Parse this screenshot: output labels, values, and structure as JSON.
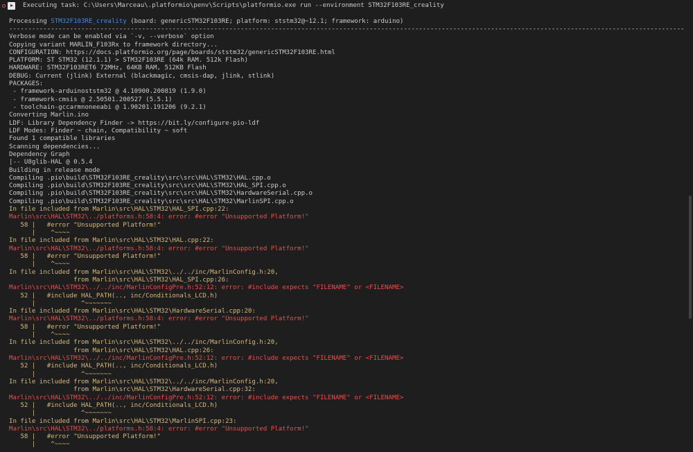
{
  "task": {
    "title": "Executing task: C:\\Users\\Marceau\\.platformio\\penv\\Scripts\\platformio.exe run --environment STM32F103RE_creality"
  },
  "colors": {
    "background": "#1e1e1e",
    "text": "#cccccc",
    "environment": "#3b8eea",
    "warning": "#d7ba7d",
    "error": "#f14c4c"
  },
  "icons": [
    "radio-icon",
    "play-icon"
  ],
  "lines": [
    {
      "parts": [
        {
          "t": "Processing ",
          "c": "def"
        },
        {
          "t": "STM32F103RE_creality",
          "c": "env"
        },
        {
          "t": " (board: genericSTM32F103RE; platform: ststm32@~12.1; framework: arduino)",
          "c": "def"
        }
      ]
    },
    {
      "parts": [
        {
          "t": "----------------------------------------------------------------------------------------------------------------------------------------------------------------------------------------------------",
          "c": "def"
        }
      ]
    },
    {
      "parts": [
        {
          "t": "Verbose mode can be enabled via `-v, --verbose` option",
          "c": "def"
        }
      ]
    },
    {
      "parts": [
        {
          "t": "Copying variant MARLIN_F103Rx to framework directory...",
          "c": "def"
        }
      ]
    },
    {
      "parts": [
        {
          "t": "CONFIGURATION: https://docs.platformio.org/page/boards/ststm32/genericSTM32F103RE.html",
          "c": "def"
        }
      ]
    },
    {
      "parts": [
        {
          "t": "PLATFORM: ST STM32 (12.1.1) > STM32F103RE (64k RAM. 512k Flash)",
          "c": "def"
        }
      ]
    },
    {
      "parts": [
        {
          "t": "HARDWARE: STM32F103RET6 72MHz, 64KB RAM, 512KB Flash",
          "c": "def"
        }
      ]
    },
    {
      "parts": [
        {
          "t": "DEBUG: Current (jlink) External (blackmagic, cmsis-dap, jlink, stlink)",
          "c": "def"
        }
      ]
    },
    {
      "parts": [
        {
          "t": "PACKAGES:",
          "c": "def"
        }
      ]
    },
    {
      "parts": [
        {
          "t": " - framework-arduinoststm32 @ 4.10900.200819 (1.9.0)",
          "c": "def"
        }
      ]
    },
    {
      "parts": [
        {
          "t": " - framework-cmsis @ 2.50501.200527 (5.5.1)",
          "c": "def"
        }
      ]
    },
    {
      "parts": [
        {
          "t": " - toolchain-gccarmnoneeabi @ 1.90201.191206 (9.2.1)",
          "c": "def"
        }
      ]
    },
    {
      "parts": [
        {
          "t": "Converting Marlin.ino",
          "c": "def"
        }
      ]
    },
    {
      "parts": [
        {
          "t": "LDF: Library Dependency Finder -> https://bit.ly/configure-pio-ldf",
          "c": "def"
        }
      ]
    },
    {
      "parts": [
        {
          "t": "LDF Modes: Finder ~ chain, Compatibility ~ soft",
          "c": "def"
        }
      ]
    },
    {
      "parts": [
        {
          "t": "Found 1 compatible libraries",
          "c": "def"
        }
      ]
    },
    {
      "parts": [
        {
          "t": "Scanning dependencies...",
          "c": "def"
        }
      ]
    },
    {
      "parts": [
        {
          "t": "Dependency Graph",
          "c": "def"
        }
      ]
    },
    {
      "parts": [
        {
          "t": "|-- U8glib-HAL @ 0.5.4",
          "c": "def"
        }
      ]
    },
    {
      "parts": [
        {
          "t": "Building in release mode",
          "c": "def"
        }
      ]
    },
    {
      "parts": [
        {
          "t": "Compiling .pio\\build\\STM32F103RE_creality\\src\\src\\HAL\\STM32\\HAL.cpp.o",
          "c": "def"
        }
      ]
    },
    {
      "parts": [
        {
          "t": "Compiling .pio\\build\\STM32F103RE_creality\\src\\src\\HAL\\STM32\\HAL_SPI.cpp.o",
          "c": "def"
        }
      ]
    },
    {
      "parts": [
        {
          "t": "Compiling .pio\\build\\STM32F103RE_creality\\src\\src\\HAL\\STM32\\HardwareSerial.cpp.o",
          "c": "def"
        }
      ]
    },
    {
      "parts": [
        {
          "t": "Compiling .pio\\build\\STM32F103RE_creality\\src\\src\\HAL\\STM32\\MarlinSPI.cpp.o",
          "c": "def"
        }
      ]
    },
    {
      "parts": [
        {
          "t": "In file included from Marlin\\src\\HAL\\STM32\\HAL_SPI.cpp:22:",
          "c": "warn"
        }
      ]
    },
    {
      "parts": [
        {
          "t": "Marlin\\src\\HAL\\STM32\\../platforms.h:58:4: error: #error \"Unsupported Platform!\"",
          "c": "err"
        }
      ]
    },
    {
      "parts": [
        {
          "t": "   58 |   #error \"Unsupported Platform!\"",
          "c": "warn"
        }
      ]
    },
    {
      "parts": [
        {
          "t": "      |    ^~~~~",
          "c": "warn"
        }
      ]
    },
    {
      "parts": [
        {
          "t": "In file included from Marlin\\src\\HAL\\STM32\\HAL.cpp:22:",
          "c": "warn"
        }
      ]
    },
    {
      "parts": [
        {
          "t": "Marlin\\src\\HAL\\STM32\\../platforms.h:58:4: error: #error \"Unsupported Platform!\"",
          "c": "err"
        }
      ]
    },
    {
      "parts": [
        {
          "t": "   58 |   #error \"Unsupported Platform!\"",
          "c": "warn"
        }
      ]
    },
    {
      "parts": [
        {
          "t": "      |    ^~~~~",
          "c": "warn"
        }
      ]
    },
    {
      "parts": [
        {
          "t": "In file included from Marlin\\src\\HAL\\STM32\\../../inc/MarlinConfig.h:20,",
          "c": "warn"
        }
      ]
    },
    {
      "parts": [
        {
          "t": "                 from Marlin\\src\\HAL\\STM32\\HAL_SPI.cpp:26:",
          "c": "warn"
        }
      ]
    },
    {
      "parts": [
        {
          "t": "Marlin\\src\\HAL\\STM32\\../../inc/MarlinConfigPre.h:52:12: error: #include expects \"FILENAME\" or <FILENAME>",
          "c": "err"
        }
      ]
    },
    {
      "parts": [
        {
          "t": "   52 |   #include HAL_PATH(.., inc/Conditionals_LCD.h)",
          "c": "warn"
        }
      ]
    },
    {
      "parts": [
        {
          "t": "      |            ^~~~~~~~",
          "c": "warn"
        }
      ]
    },
    {
      "parts": [
        {
          "t": "In file included from Marlin\\src\\HAL\\STM32\\HardwareSerial.cpp:20:",
          "c": "warn"
        }
      ]
    },
    {
      "parts": [
        {
          "t": "Marlin\\src\\HAL\\STM32\\../platforms.h:58:4: error: #error \"Unsupported Platform!\"",
          "c": "err"
        }
      ]
    },
    {
      "parts": [
        {
          "t": "   58 |   #error \"Unsupported Platform!\"",
          "c": "warn"
        }
      ]
    },
    {
      "parts": [
        {
          "t": "      |    ^~~~~",
          "c": "warn"
        }
      ]
    },
    {
      "parts": [
        {
          "t": "In file included from Marlin\\src\\HAL\\STM32\\../../inc/MarlinConfig.h:20,",
          "c": "warn"
        }
      ]
    },
    {
      "parts": [
        {
          "t": "                 from Marlin\\src\\HAL\\STM32\\HAL.cpp:26:",
          "c": "warn"
        }
      ]
    },
    {
      "parts": [
        {
          "t": "Marlin\\src\\HAL\\STM32\\../../inc/MarlinConfigPre.h:52:12: error: #include expects \"FILENAME\" or <FILENAME>",
          "c": "err"
        }
      ]
    },
    {
      "parts": [
        {
          "t": "   52 |   #include HAL_PATH(.., inc/Conditionals_LCD.h)",
          "c": "warn"
        }
      ]
    },
    {
      "parts": [
        {
          "t": "      |            ^~~~~~~~",
          "c": "warn"
        }
      ]
    },
    {
      "parts": [
        {
          "t": "In file included from Marlin\\src\\HAL\\STM32\\../../inc/MarlinConfig.h:20,",
          "c": "warn"
        }
      ]
    },
    {
      "parts": [
        {
          "t": "                 from Marlin\\src\\HAL\\STM32\\HardwareSerial.cpp:32:",
          "c": "warn"
        }
      ]
    },
    {
      "parts": [
        {
          "t": "Marlin\\src\\HAL\\STM32\\../../inc/MarlinConfigPre.h:52:12: error: #include expects \"FILENAME\" or <FILENAME>",
          "c": "err"
        }
      ]
    },
    {
      "parts": [
        {
          "t": "   52 |   #include HAL_PATH(.., inc/Conditionals_LCD.h)",
          "c": "warn"
        }
      ]
    },
    {
      "parts": [
        {
          "t": "      |            ^~~~~~~~",
          "c": "warn"
        }
      ]
    },
    {
      "parts": [
        {
          "t": "In file included from Marlin\\src\\HAL\\STM32\\MarlinSPI.cpp:23:",
          "c": "warn"
        }
      ]
    },
    {
      "parts": [
        {
          "t": "Marlin\\src\\HAL\\STM32\\../platforms.h:58:4: error: #error \"Unsupported Platform!\"",
          "c": "err"
        }
      ]
    },
    {
      "parts": [
        {
          "t": "   58 |   #error \"Unsupported Platform!\"",
          "c": "warn"
        }
      ]
    },
    {
      "parts": [
        {
          "t": "      |    ^~~~~",
          "c": "warn"
        }
      ]
    }
  ]
}
